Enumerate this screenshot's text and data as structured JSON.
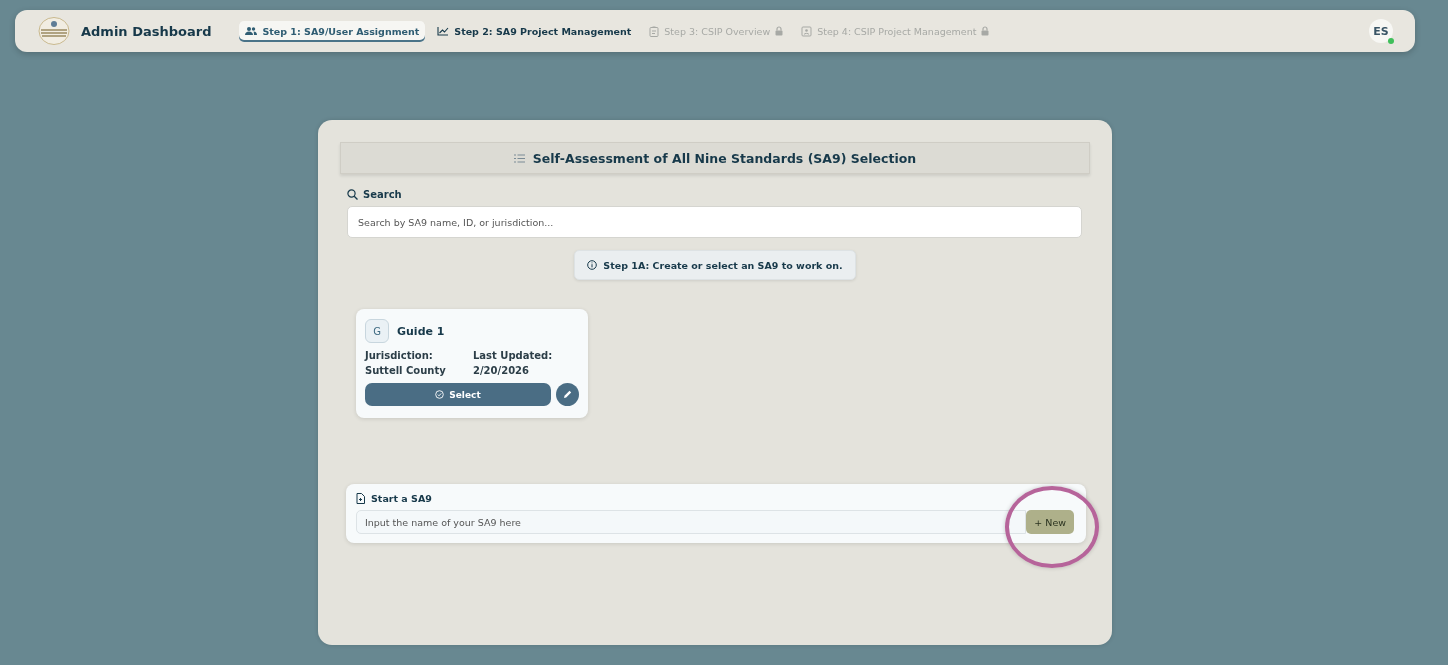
{
  "app": {
    "title": "Admin Dashboard"
  },
  "tabs": [
    {
      "label": "Step 1: SA9/User Assignment",
      "selected": true,
      "locked": false
    },
    {
      "label": "Step 2: SA9 Project Management",
      "selected": false,
      "locked": false
    },
    {
      "label": "Step 3: CSIP Overview",
      "selected": false,
      "locked": true
    },
    {
      "label": "Step 4: CSIP Project Management",
      "selected": false,
      "locked": true
    }
  ],
  "user": {
    "initials": "ES",
    "online": true
  },
  "panel": {
    "title": "Self-Assessment of All Nine Standards (SA9) Selection",
    "search_label": "Search",
    "search": {
      "placeholder": "Search by SA9 name, ID, or jurisdiction..."
    },
    "info": "Step 1A: Create or select an SA9 to work on.",
    "cards": [
      {
        "letter": "G",
        "name": "Guide 1",
        "jurisdiction_label": "Jurisdiction:",
        "jurisdiction": "Suttell County",
        "updated_label": "Last Updated:",
        "updated": "2/20/2026",
        "select_button": "Select"
      }
    ],
    "start": {
      "title": "Start a SA9",
      "placeholder": "Input the name of your SA9 here",
      "button": "+ New",
      "highlighted": true
    }
  }
}
